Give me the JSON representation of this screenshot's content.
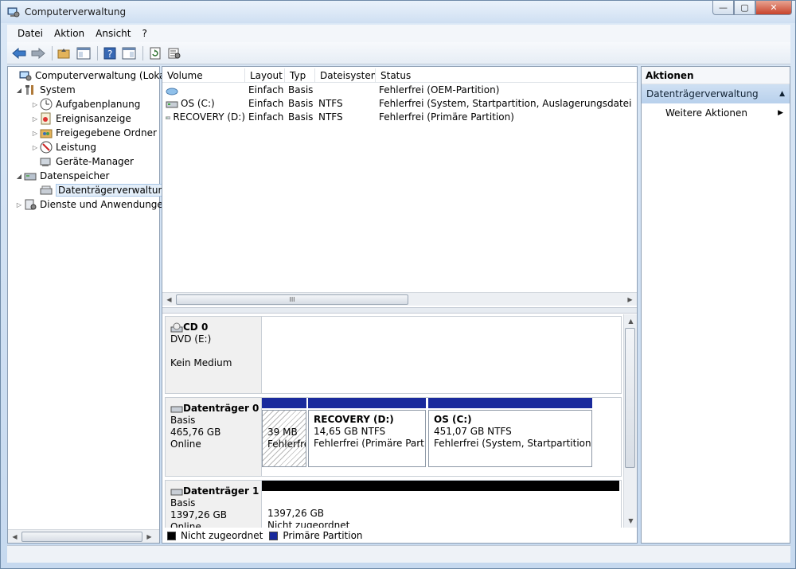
{
  "window": {
    "title": "Computerverwaltung",
    "buttons": {
      "minimize": "—",
      "maximize": "▢",
      "close": "✕"
    }
  },
  "menu": [
    "Datei",
    "Aktion",
    "Ansicht",
    "?"
  ],
  "tree": [
    {
      "label": "Computerverwaltung (Lokal)",
      "icon": "computer-management-icon"
    },
    {
      "label": "System",
      "icon": "tools-icon"
    },
    {
      "label": "Aufgabenplanung",
      "icon": "clock-icon"
    },
    {
      "label": "Ereignisanzeige",
      "icon": "event-viewer-icon"
    },
    {
      "label": "Freigegebene Ordner",
      "icon": "shared-folder-icon"
    },
    {
      "label": "Leistung",
      "icon": "performance-icon"
    },
    {
      "label": "Geräte-Manager",
      "icon": "device-manager-icon"
    },
    {
      "label": "Datenspeicher",
      "icon": "storage-icon"
    },
    {
      "label": "Datenträgerverwaltung",
      "icon": "disk-management-icon"
    },
    {
      "label": "Dienste und Anwendungen",
      "icon": "services-icon"
    }
  ],
  "volume_table": {
    "columns": [
      "Volume",
      "Layout",
      "Typ",
      "Dateisystem",
      "Status"
    ],
    "rows": [
      {
        "volume": "",
        "layout": "Einfach",
        "type": "Basis",
        "fs": "",
        "status": "Fehlerfrei (OEM-Partition)"
      },
      {
        "volume": "OS (C:)",
        "layout": "Einfach",
        "type": "Basis",
        "fs": "NTFS",
        "status": "Fehlerfrei (System, Startpartition, Auslagerungsdatei, Aktiv, A"
      },
      {
        "volume": "RECOVERY (D:)",
        "layout": "Einfach",
        "type": "Basis",
        "fs": "NTFS",
        "status": "Fehlerfrei (Primäre Partition)"
      }
    ],
    "scroll_thumb_label": "III"
  },
  "disks": {
    "cd0": {
      "name": "CD 0",
      "line1": "DVD (E:)",
      "line2": "Kein Medium"
    },
    "disk0": {
      "name": "Datenträger 0",
      "type": "Basis",
      "size": "465,76 GB",
      "state": "Online",
      "partitions": [
        {
          "title": "",
          "size": "39 MB",
          "status": "Fehlerfrei"
        },
        {
          "title": "RECOVERY  (D:)",
          "size": "14,65 GB NTFS",
          "status": "Fehlerfrei (Primäre Partitio"
        },
        {
          "title": "OS  (C:)",
          "size": "451,07 GB NTFS",
          "status": "Fehlerfrei (System, Startpartition, Au"
        }
      ]
    },
    "disk1": {
      "name": "Datenträger 1",
      "type": "Basis",
      "size": "1397,26 GB",
      "state": "Online",
      "partition": {
        "size": "1397,26 GB",
        "status": "Nicht zugeordnet"
      }
    }
  },
  "legend": [
    {
      "label": "Nicht zugeordnet",
      "color": "#000000"
    },
    {
      "label": "Primäre Partition",
      "color": "#1a2a9c"
    }
  ],
  "actions": {
    "header": "Aktionen",
    "section": "Datenträgerverwaltung",
    "items": [
      "Weitere Aktionen"
    ]
  }
}
